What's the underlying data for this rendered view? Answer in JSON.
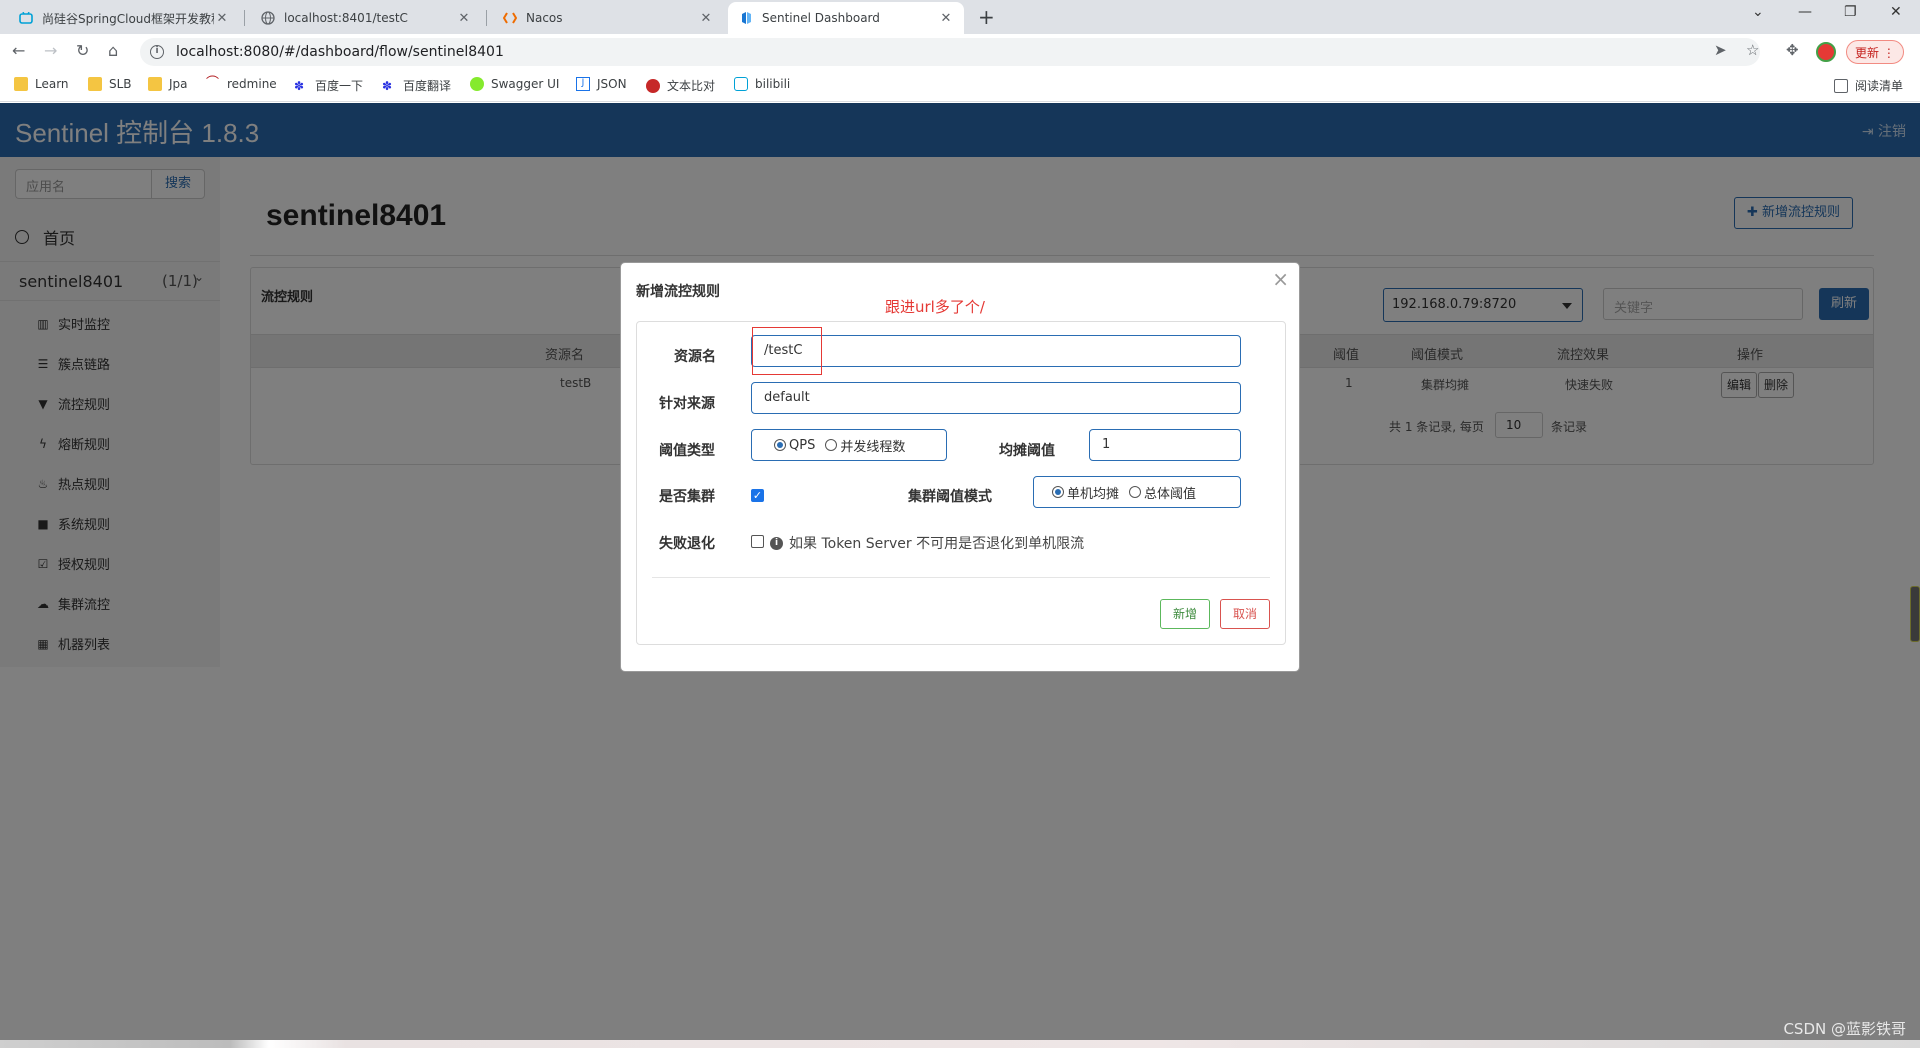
{
  "browser": {
    "tabs": [
      {
        "title": "尚硅谷SpringCloud框架开发教程",
        "active": false
      },
      {
        "title": "localhost:8401/testC",
        "active": false
      },
      {
        "title": "Nacos",
        "active": false
      },
      {
        "title": "Sentinel Dashboard",
        "active": true
      }
    ],
    "url": "localhost:8080/#/dashboard/flow/sentinel8401",
    "update_label": "更新",
    "bookmarks": [
      "Learn",
      "SLB",
      "Jpa",
      "redmine",
      "百度一下",
      "百度翻译",
      "Swagger UI",
      "JSON",
      "文本比对",
      "bilibili"
    ],
    "reading_list": "阅读清单"
  },
  "app": {
    "title": "Sentinel 控制台 1.8.3",
    "logout": "注销"
  },
  "sidebar": {
    "search_placeholder": "应用名",
    "search_button": "搜索",
    "home": "首页",
    "app_name": "sentinel8401",
    "app_count": "(1/1)",
    "items": [
      {
        "label": "实时监控",
        "icon": "bar-chart-icon"
      },
      {
        "label": "簇点链路",
        "icon": "list-icon"
      },
      {
        "label": "流控规则",
        "icon": "filter-icon"
      },
      {
        "label": "熔断规则",
        "icon": "flash-icon"
      },
      {
        "label": "热点规则",
        "icon": "fire-icon"
      },
      {
        "label": "系统规则",
        "icon": "lock-icon"
      },
      {
        "label": "授权规则",
        "icon": "check-square-icon"
      },
      {
        "label": "集群流控",
        "icon": "cloud-icon"
      },
      {
        "label": "机器列表",
        "icon": "th-list-icon"
      }
    ]
  },
  "main": {
    "page_title": "sentinel8401",
    "add_rule_button": "新增流控规则",
    "panel_title": "流控规则",
    "machine_select": "192.168.0.79:8720",
    "keyword_placeholder": "关键字",
    "refresh_button": "刷新",
    "columns": {
      "resource": "资源名",
      "threshold": "阈值",
      "threshold_mode": "阈值模式",
      "effect": "流控效果",
      "actions": "操作"
    },
    "rows": [
      {
        "resource": "testB",
        "threshold": "1",
        "threshold_mode": "集群均摊",
        "effect": "快速失败",
        "edit": "编辑",
        "delete": "删除"
      }
    ],
    "pager_prefix": "共 1 条记录, 每页",
    "page_size": "10",
    "pager_suffix": "条记录"
  },
  "modal": {
    "title": "新增流控规则",
    "close": "×",
    "resource_label": "资源名",
    "resource_value": "/testC",
    "source_label": "针对来源",
    "source_value": "default",
    "threshold_type_label": "阈值类型",
    "qps_option": "QPS",
    "thread_option": "并发线程数",
    "avg_threshold_label": "均摊阈值",
    "avg_threshold_value": "1",
    "cluster_label": "是否集群",
    "cluster_checked": true,
    "cluster_mode_label": "集群阈值模式",
    "single_avg_option": "单机均摊",
    "global_option": "总体阈值",
    "fallback_label": "失败退化",
    "fallback_checked": false,
    "fallback_hint": "如果 Token Server 不可用是否退化到单机限流",
    "add_button": "新增",
    "cancel_button": "取消"
  },
  "annotation": {
    "text": "跟进url多了个/",
    "color": "#e53935"
  },
  "watermark": "CSDN @蓝影铁哥",
  "colors": {
    "brand_blue": "#2a6db3",
    "success_green": "#5cb85c",
    "danger_red": "#d9534f"
  }
}
